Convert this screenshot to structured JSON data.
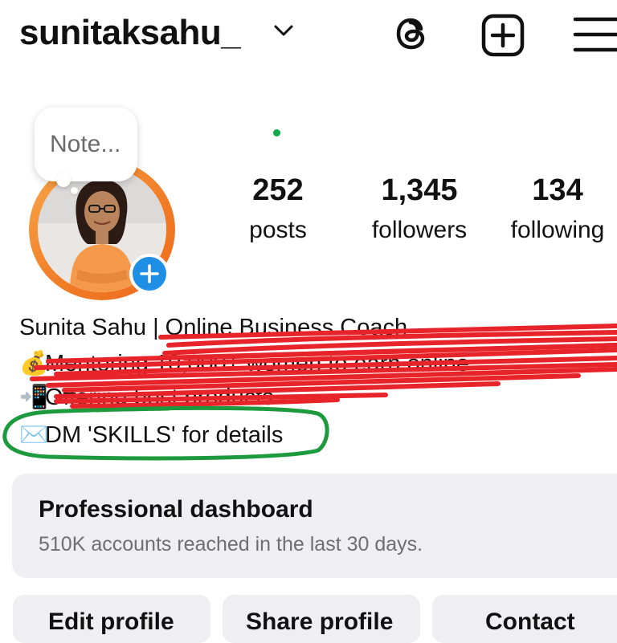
{
  "header": {
    "username": "sunitaksahu_",
    "chevron_icon": "chevron-down-icon",
    "icons": [
      "threads-icon",
      "add-post-icon",
      "hamburger-menu-icon"
    ]
  },
  "note": {
    "placeholder": "Note..."
  },
  "stats": [
    {
      "count": "252",
      "label": "posts"
    },
    {
      "count": "1,345",
      "label": "followers"
    },
    {
      "count": "134",
      "label": "following"
    }
  ],
  "bio": {
    "name_prefix": "Sunita Sahu | ",
    "name_title": "Online Business Coach",
    "line1_emoji": "💰",
    "line1_text": "Mentoring 10,000+ women to earn online",
    "line2_emoji": "📲",
    "line2_text": "Offering best products",
    "line3_emoji": "✉️",
    "line3_text": "DM 'SKILLS' for details"
  },
  "dashboard": {
    "title": "Professional dashboard",
    "subtitle": "510K accounts reached in the last 30 days."
  },
  "buttons": {
    "edit_profile": "Edit profile",
    "share_profile": "Share profile",
    "contact": "Contact"
  },
  "colors": {
    "story_ring": "#f07b25",
    "add_story": "#1f8fe5",
    "annotation_red": "#e8242b",
    "annotation_green": "#1e9a3e",
    "active_dot": "#0fa84a"
  }
}
